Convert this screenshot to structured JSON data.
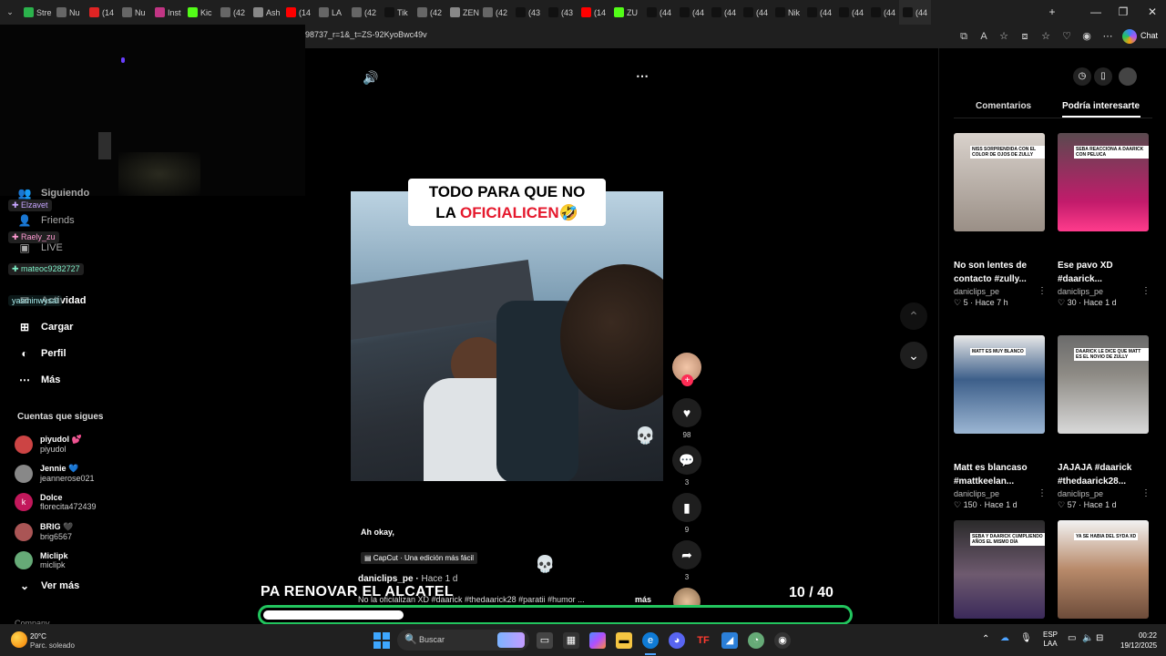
{
  "browser": {
    "tabs": [
      "Stre",
      "Nu",
      "(14",
      "Nu",
      "Inst",
      "Kic",
      "(42",
      "Ash",
      "(14",
      "LA",
      "(42",
      "Tik",
      "(42",
      "ZEN",
      "(42",
      "(43",
      "(43",
      "(14",
      "ZU",
      "(44",
      "(44",
      "(44",
      "(44",
      "Nik",
      "(44",
      "(44",
      "(44",
      "(44"
    ],
    "url": "98737_r=1&_t=ZS-92KyoBwc49v",
    "chat_label": "Chat",
    "new_tab": "+",
    "minimize": "—",
    "restore": "❐",
    "close": "✕"
  },
  "chat_overlay": {
    "users": [
      {
        "name": "Elzavet",
        "color": "#c7a6ff"
      },
      {
        "name": "Raely_zu",
        "color": "#ff9ad2"
      },
      {
        "name": "mateoc9282727",
        "color": "#7ff0c8"
      },
      {
        "name": "yasminwysal",
        "color": "#aee"
      }
    ]
  },
  "sidebar": {
    "nav": [
      {
        "label": "Siguiendo",
        "icon": "people-icon"
      },
      {
        "label": "Friends",
        "icon": "friends-icon"
      },
      {
        "label": "LIVE",
        "icon": "live-icon"
      },
      {
        "label": "Actividad",
        "icon": "activity-icon"
      },
      {
        "label": "Cargar",
        "icon": "upload-icon"
      },
      {
        "label": "Perfil",
        "icon": "profile-icon"
      },
      {
        "label": "Más",
        "icon": "more-icon"
      }
    ],
    "following_title": "Cuentas que sigues",
    "following": [
      {
        "name": "piyudol",
        "handle": "piyudol",
        "badge": "💕",
        "avatar_color": "#c44"
      },
      {
        "name": "Jennie",
        "handle": "jeannerose021",
        "badge": "💙",
        "avatar_color": "#888"
      },
      {
        "name": "Dolce",
        "handle": "florecita472439",
        "badge": "",
        "avatar_color": "#c2185b",
        "initial": "k"
      },
      {
        "name": "BRIG",
        "handle": "brig6567",
        "badge": "🖤",
        "avatar_color": "#a55"
      },
      {
        "name": "Miclipk",
        "handle": "miclipk",
        "badge": "",
        "avatar_color": "#6a7"
      }
    ],
    "see_more": "Ver más",
    "company": "Company"
  },
  "video": {
    "caption_line1": "TODO PARA QUE NO",
    "caption_line2a": "LA ",
    "caption_line2b": "OFICIALICEN",
    "caption_emoji": "🤣",
    "comment_text": "Ah okay,",
    "capcut": "CapCut · Una edición más fácil",
    "author": "daniclips_pe",
    "posted": "Hace 1 d",
    "description": "No la oficializan XD #daarick #thedaarick28 #paratii #humor ...",
    "more": "más",
    "likes": "98",
    "comments": "3",
    "saves": "9",
    "shares": "3"
  },
  "overlay": {
    "big_text": "PA RENOVAR EL ALCATEL",
    "counter": "10  / 40",
    "progress_fraction": 0.24
  },
  "rpanel": {
    "tab_comments": "Comentarios",
    "tab_interest": "Podría interesarte",
    "cards": [
      {
        "title": "No son lentes de contacto #zully...",
        "user": "daniclips_pe",
        "likes": "5",
        "time": "Hace 7 h",
        "label": "NISS SORPRENDIDA CON EL COLOR DE OJOS DE ZULLY"
      },
      {
        "title": "Ese pavo XD #daarick...",
        "user": "daniclips_pe",
        "likes": "30",
        "time": "Hace 1 d",
        "label": "SEBA REACCIONA A DAARICK CON PELUCA"
      },
      {
        "title": "Matt es blancaso #mattkeelan...",
        "user": "daniclips_pe",
        "likes": "150",
        "time": "Hace 1 d",
        "label": "MATT ES MUY BLANCO"
      },
      {
        "title": "JAJAJA #daarick #thedaarick28...",
        "user": "daniclips_pe",
        "likes": "57",
        "time": "Hace 1 d",
        "label": "DAARICK LE DICE QUE MATT ES EL NOVIO DE ZULLY"
      },
      {
        "title": "",
        "user": "",
        "likes": "",
        "time": "",
        "label": "SEBA Y DAARICK CUMPLIENDO AÑOS EL MISMO DÍA"
      },
      {
        "title": "",
        "user": "",
        "likes": "",
        "time": "",
        "label": "YA SE HABIA DEL SYDA XD"
      }
    ]
  },
  "taskbar": {
    "weather_temp": "20°C",
    "weather_desc": "Parc. soleado",
    "search": "Buscar",
    "lang1": "ESP",
    "lang2": "LAA",
    "time": "00:22",
    "date": "19/12/2025"
  }
}
